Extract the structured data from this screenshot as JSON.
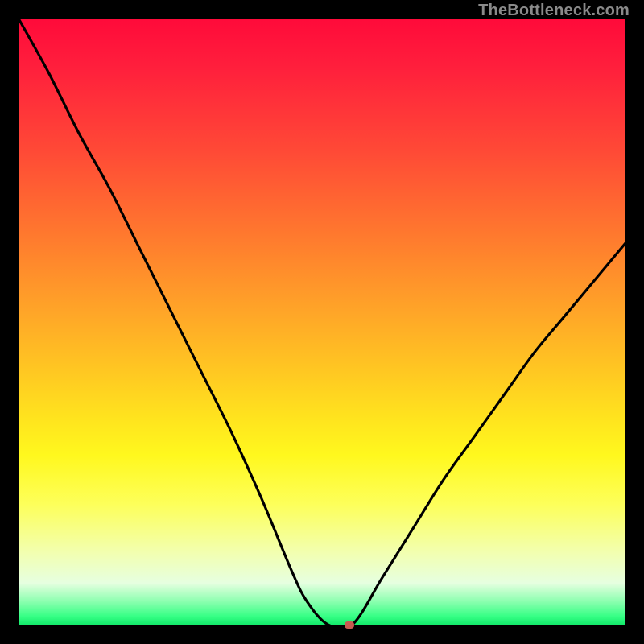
{
  "watermark": "TheBottleneck.com",
  "colors": {
    "frame": "#000000",
    "curve": "#000000",
    "marker": "#c85a50",
    "gradient_top": "#ff0a3a",
    "gradient_bottom": "#10e868"
  },
  "chart_data": {
    "type": "line",
    "title": "",
    "xlabel": "",
    "ylabel": "",
    "xlim": [
      0,
      100
    ],
    "ylim": [
      0,
      100
    ],
    "x": [
      0,
      5,
      10,
      15,
      20,
      25,
      30,
      35,
      40,
      45,
      47.5,
      51,
      55,
      60,
      65,
      70,
      75,
      80,
      85,
      90,
      95,
      100
    ],
    "values": [
      100,
      91,
      81,
      72,
      62,
      52,
      42,
      32,
      21,
      9,
      4,
      0,
      0,
      8,
      16,
      24,
      31,
      38,
      45,
      51,
      57,
      63
    ],
    "notch_x_range": [
      50,
      56.5
    ],
    "marker": {
      "x": 54.5,
      "y": 0
    },
    "description": "Black V-shaped bottleneck curve over red-to-green vertical gradient; minimum (notch) flattens to zero near x≈50–56 with a small rounded marker at the trough."
  }
}
